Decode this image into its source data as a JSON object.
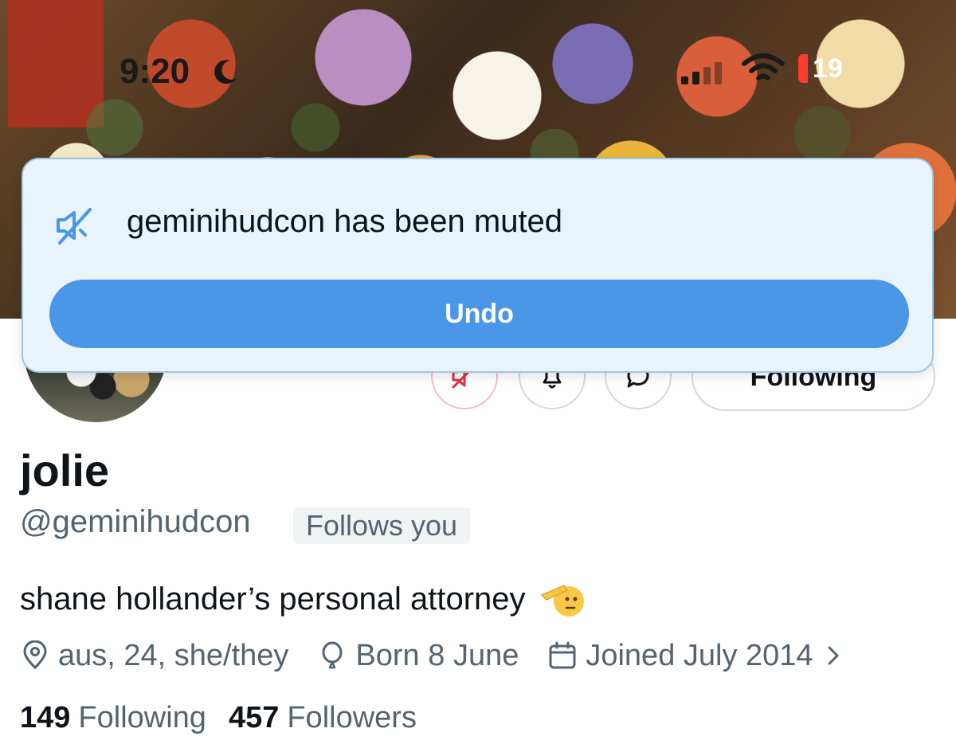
{
  "status_bar": {
    "time": "9:20",
    "battery": "19"
  },
  "toast": {
    "message": "geminihudcon has been muted",
    "undo_label": "Undo"
  },
  "actions": {
    "following_label": "Following"
  },
  "profile": {
    "display_name": "jolie",
    "handle": "@geminihudcon",
    "follows_you": "Follows you",
    "bio": "shane hollander’s personal attorney",
    "location": "aus, 24, she/they",
    "birthday": "Born 8 June",
    "joined": "Joined July 2014",
    "following_count": "149",
    "following_label": "Following",
    "followers_count": "457",
    "followers_label": "Followers"
  },
  "colors": {
    "accent": "#4a97e8",
    "toast_bg": "#e8f3fc",
    "muted_red": "#e0303a",
    "secondary_text": "#536471"
  }
}
